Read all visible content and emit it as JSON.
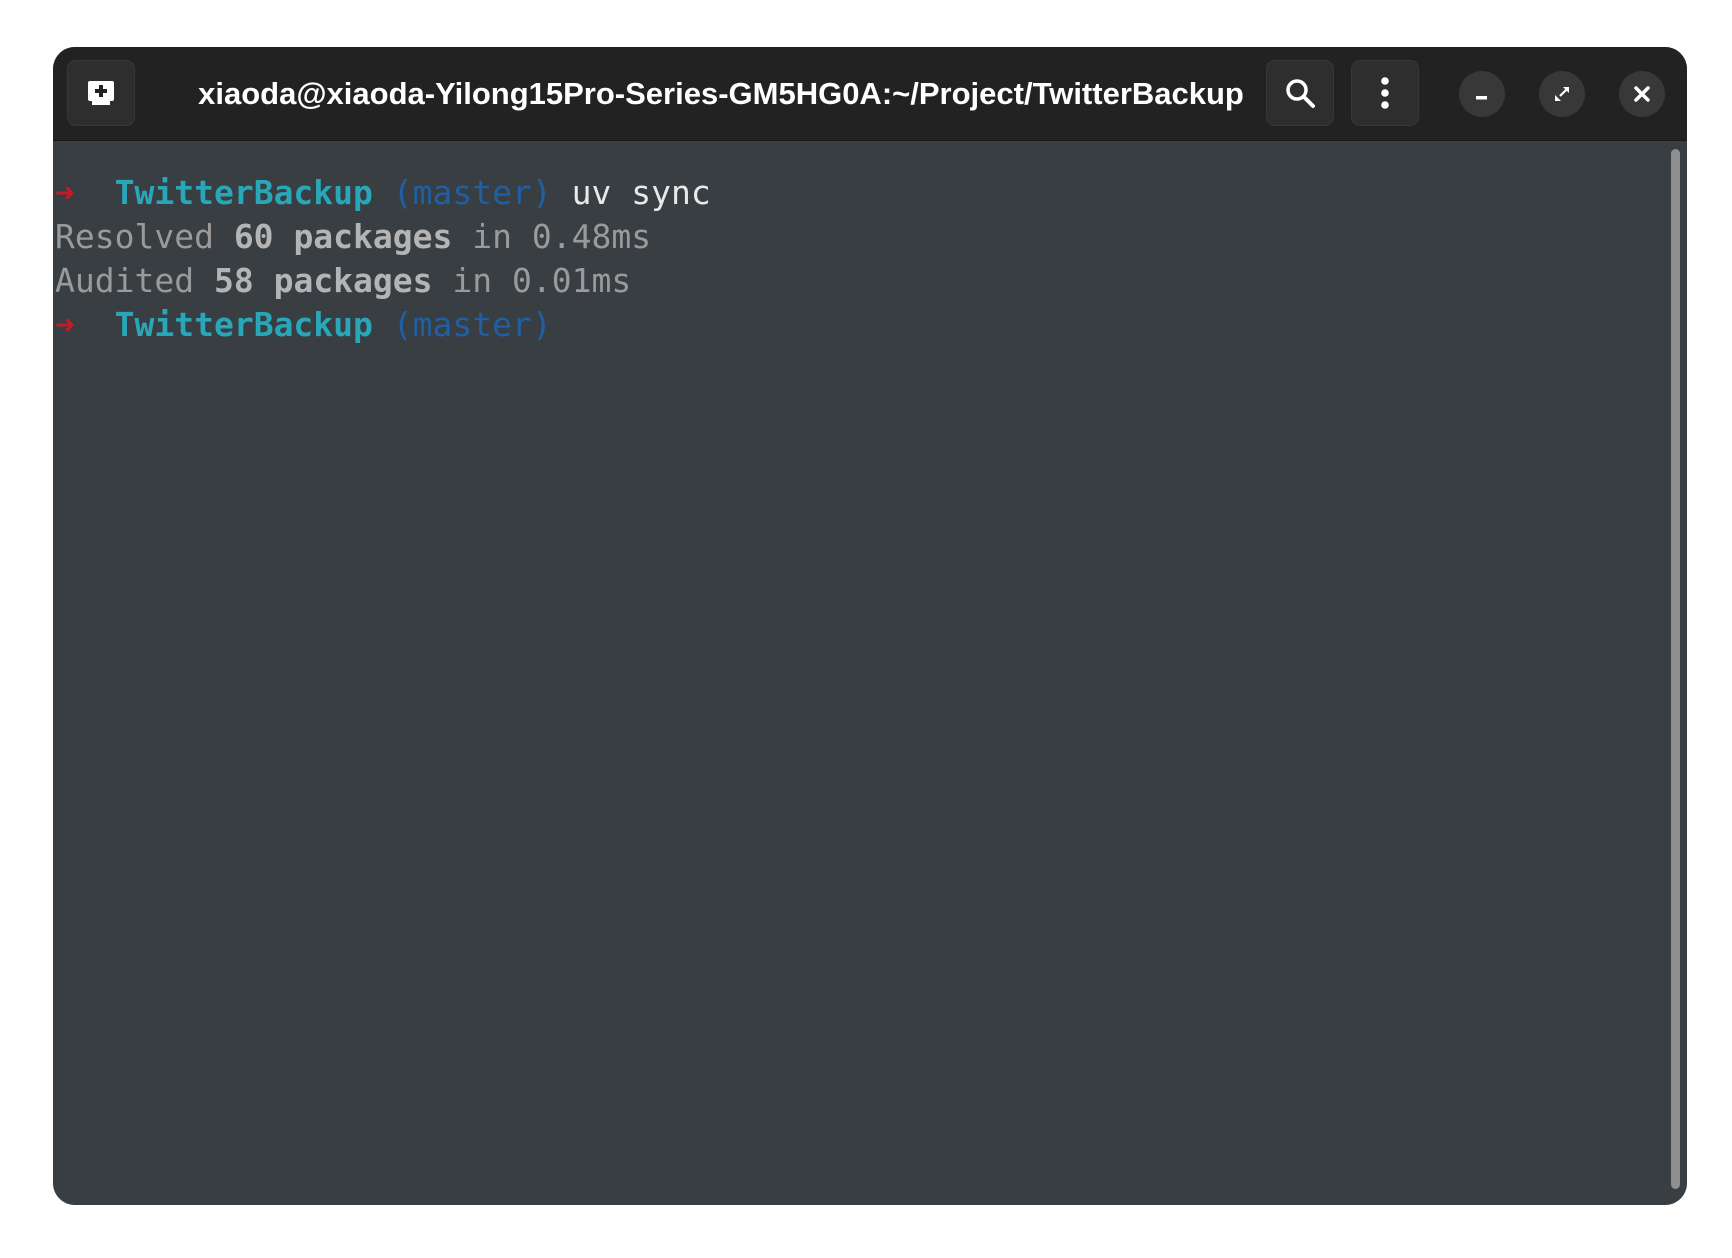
{
  "window": {
    "title": "xiaoda@xiaoda-Yilong15Pro-Series-GM5HG0A:~/Project/TwitterBackup"
  },
  "titlebar": {
    "buttons": {
      "new_tab_icon": "new-tab-icon",
      "search_icon": "search-icon",
      "menu_icon": "kebab-menu-icon",
      "minimize_icon": "minimize-icon",
      "restore_icon": "restore-icon",
      "close_icon": "close-icon"
    }
  },
  "terminal": {
    "lines": [
      {
        "arrow": "➜",
        "dir": "TwitterBackup",
        "branch": "(master)",
        "cmd": "uv sync"
      },
      {
        "pre": "Resolved ",
        "count": "60",
        "word": "packages",
        "post": " in 0.48ms"
      },
      {
        "pre": "Audited ",
        "count": "58",
        "word": "packages",
        "post": " in 0.01ms"
      },
      {
        "arrow": "➜",
        "dir": "TwitterBackup",
        "branch": "(master)"
      }
    ]
  },
  "colors": {
    "background": "#393e42",
    "titlebar": "#222222",
    "prompt_arrow": "#c41a2a",
    "prompt_dir": "#27a7b8",
    "prompt_branch": "#1f5fa3"
  }
}
